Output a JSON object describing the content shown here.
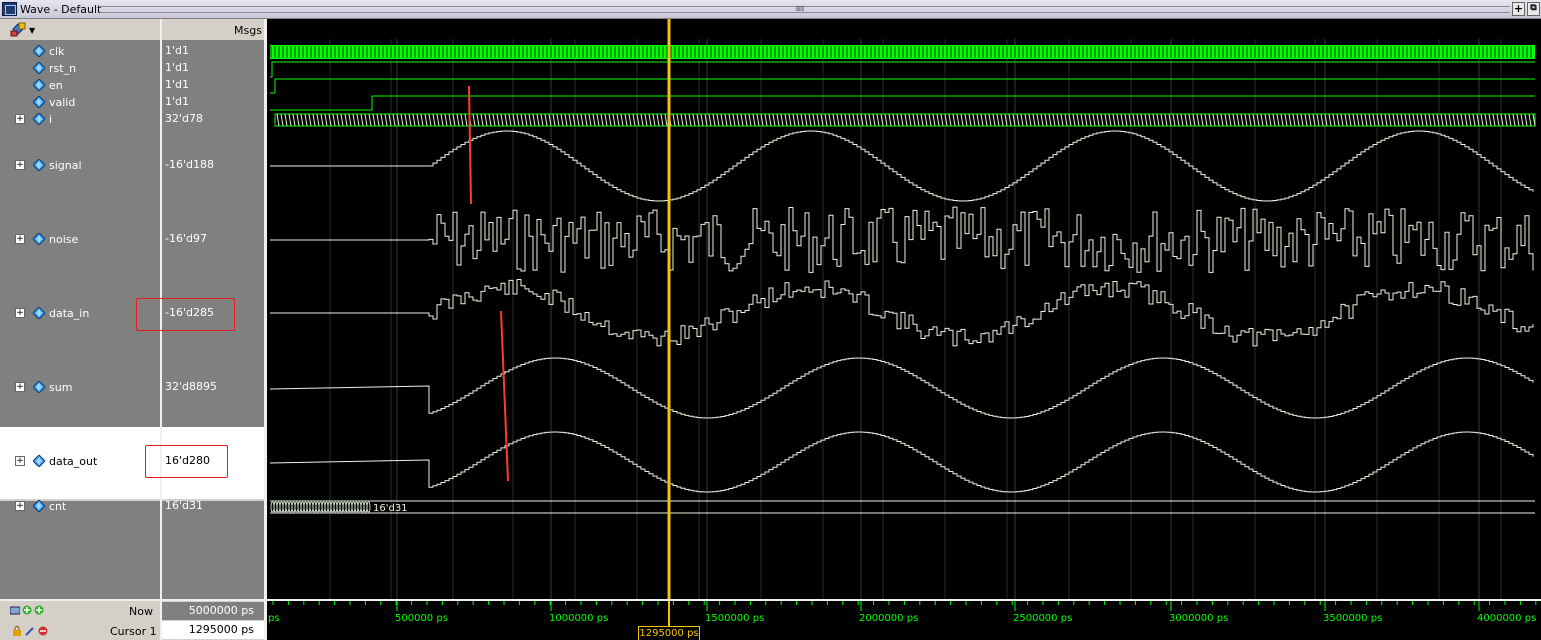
{
  "window": {
    "title": "Wave - Default"
  },
  "panel": {
    "msgs_label": "Msgs"
  },
  "signals": [
    {
      "name": "clk",
      "value": "1'd1",
      "expandable": false
    },
    {
      "name": "rst_n",
      "value": "1'd1",
      "expandable": false
    },
    {
      "name": "en",
      "value": "1'd1",
      "expandable": false
    },
    {
      "name": "valid",
      "value": "1'd1",
      "expandable": false
    },
    {
      "name": "i",
      "value": "32'd78",
      "expandable": true
    },
    {
      "name": "signal",
      "value": "-16'd188",
      "expandable": true
    },
    {
      "name": "noise",
      "value": "-16'd97",
      "expandable": true
    },
    {
      "name": "data_in",
      "value": "-16'd285",
      "expandable": true
    },
    {
      "name": "sum",
      "value": "32'd8895",
      "expandable": true
    },
    {
      "name": "data_out",
      "value": "16'd280",
      "expandable": true
    },
    {
      "name": "cnt",
      "value": "16'd31",
      "expandable": true
    }
  ],
  "cnt_bus_label": "16'd31",
  "status": {
    "now_label": "Now",
    "now_value": "5000000 ps",
    "cursor_label": "Cursor 1",
    "cursor_value": "1295000 ps"
  },
  "timeline": {
    "start_label": "ps",
    "ticks": [
      "500000 ps",
      "1000000 ps",
      "1500000 ps",
      "2000000 ps",
      "2500000 ps",
      "3000000 ps",
      "3500000 ps",
      "4000000 ps"
    ],
    "cursor_time_ps": 1295000,
    "range_ps": [
      0,
      4100000
    ]
  },
  "colors": {
    "wave_green": "#00ff00",
    "wave_white": "#e8f5e0",
    "cursor": "#f5c400",
    "annotation": "#ff3b30",
    "grid": "#3a3a3a"
  },
  "icons": {
    "signal": "blue-diamond-icon",
    "expand": "plus-box-icon",
    "lock": "lock-icon",
    "add_cursor": "add-cursor-icon",
    "remove_cursor": "remove-cursor-icon"
  }
}
